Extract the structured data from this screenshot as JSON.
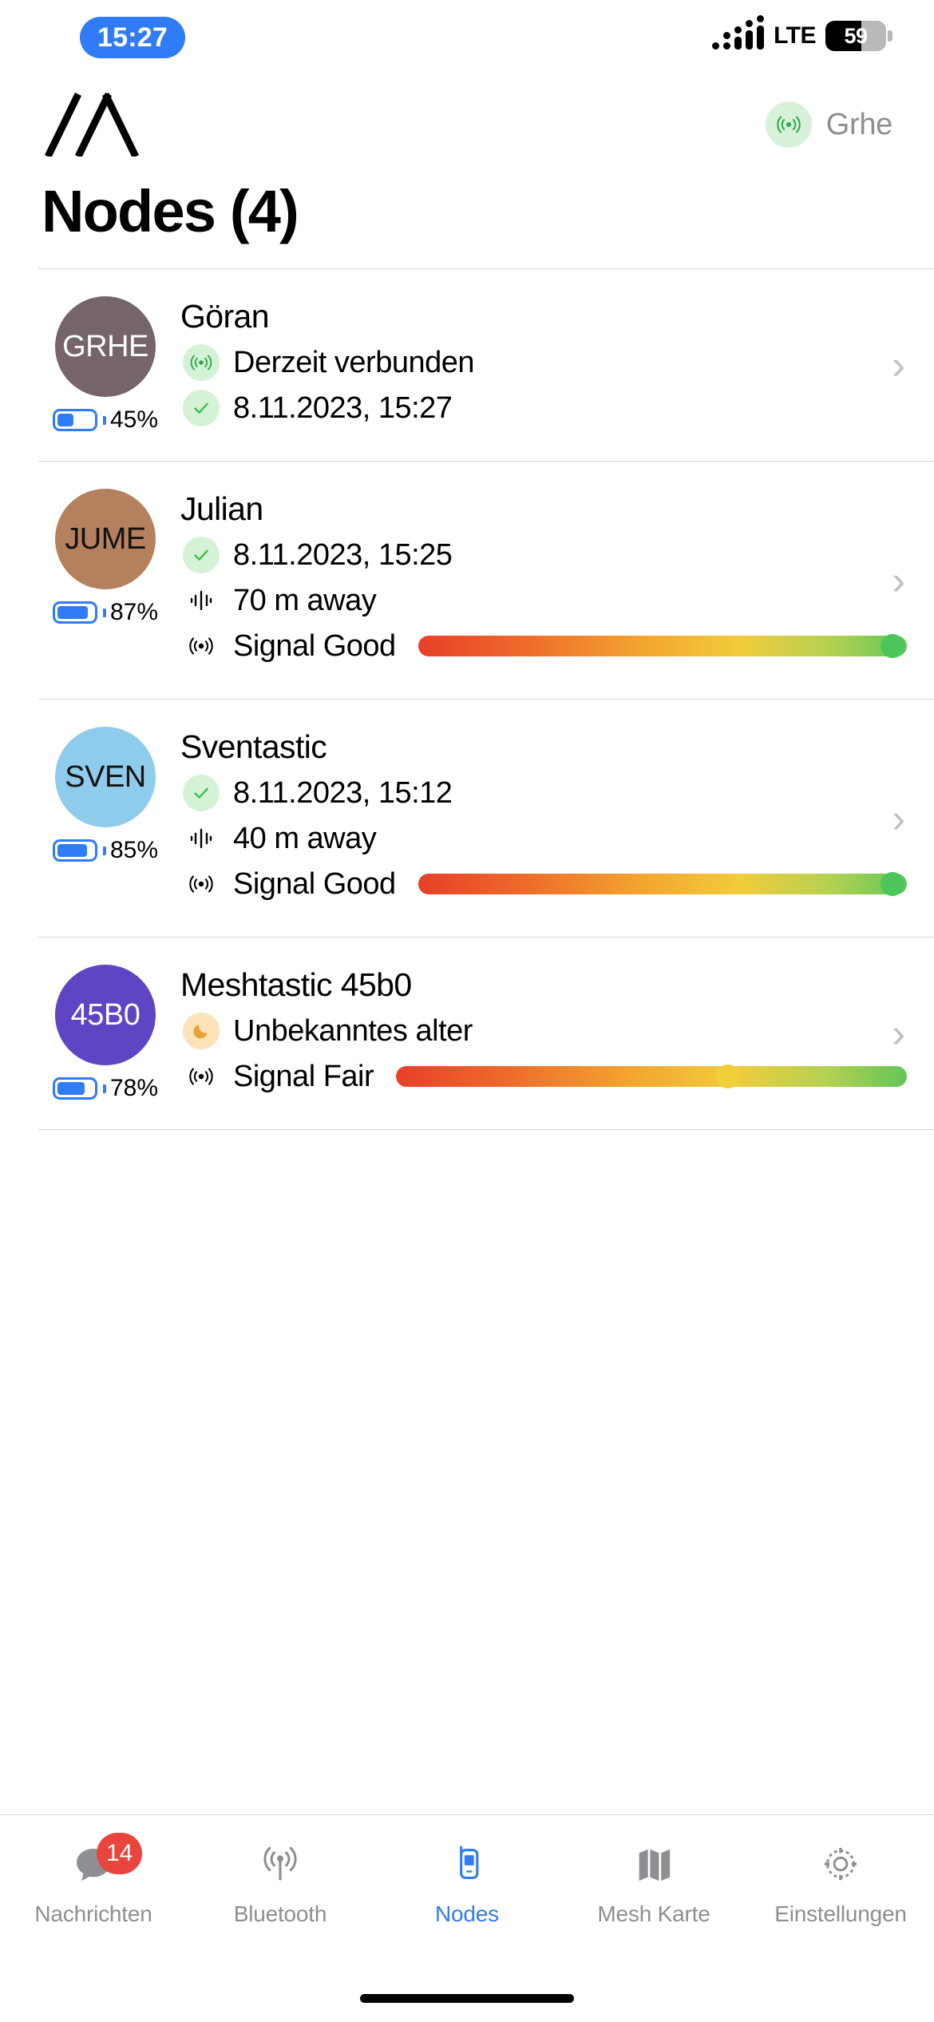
{
  "status_bar": {
    "time": "15:27",
    "carrier_network": "LTE",
    "battery_percent": "59",
    "battery_level": 59,
    "signal_icon": "cellular-dots-icon"
  },
  "header": {
    "logo_icon": "meshtastic-logo-icon",
    "connection_icon": "broadcast-icon",
    "connection_label": "Grhe",
    "connection_chip_color": "#D7F2D9"
  },
  "page": {
    "title": "Nodes (4)"
  },
  "colors": {
    "accent": "#307BF6",
    "badge_red": "#E8453C",
    "green_badge_bg": "#D4F3D6",
    "orange_badge_bg": "#FBE2B8",
    "inactive_gray": "#8E8E93"
  },
  "nodes": [
    {
      "short_name": "GRHE",
      "name": "Göran",
      "avatar_color": "#76646D",
      "avatar_text_color": "#FFFFFF",
      "battery_percent": "45%",
      "battery_level": 45,
      "meta": [
        {
          "icon": "broadcast-icon",
          "badge": "green",
          "text": "Derzeit verbunden"
        },
        {
          "icon": "check-icon",
          "badge": "green",
          "text": "8.11.2023, 15:27"
        }
      ],
      "signal": null,
      "chevron": "chevron-right-icon"
    },
    {
      "short_name": "JUME",
      "name": "Julian",
      "avatar_color": "#B5805D",
      "avatar_text_color": "#111111",
      "battery_percent": "87%",
      "battery_level": 87,
      "meta": [
        {
          "icon": "check-icon",
          "badge": "green",
          "text": "8.11.2023, 15:25"
        },
        {
          "icon": "waveform-icon",
          "badge": "none",
          "text": "70 m away"
        }
      ],
      "signal": {
        "icon": "signal-waves-icon",
        "label": "Signal Good",
        "position_pct": 97,
        "dot_color": "#4CC55A"
      },
      "chevron": "chevron-right-icon"
    },
    {
      "short_name": "SVEN",
      "name": "Sventastic",
      "avatar_color": "#8FCBEA",
      "avatar_text_color": "#111111",
      "battery_percent": "85%",
      "battery_level": 85,
      "meta": [
        {
          "icon": "check-icon",
          "badge": "green",
          "text": "8.11.2023, 15:12"
        },
        {
          "icon": "waveform-icon",
          "badge": "none",
          "text": "40 m away"
        }
      ],
      "signal": {
        "icon": "signal-waves-icon",
        "label": "Signal Good",
        "position_pct": 97,
        "dot_color": "#4CC55A"
      },
      "chevron": "chevron-right-icon"
    },
    {
      "short_name": "45B0",
      "name": "Meshtastic 45b0",
      "avatar_color": "#5F44C4",
      "avatar_text_color": "#FFFFFF",
      "battery_percent": "78%",
      "battery_level": 78,
      "meta": [
        {
          "icon": "moon-icon",
          "badge": "orange",
          "text": "Unbekanntes alter"
        }
      ],
      "signal": {
        "icon": "signal-waves-icon",
        "label": "Signal Fair",
        "position_pct": 65,
        "dot_color": "#F1D03C"
      },
      "chevron": "chevron-right-icon"
    }
  ],
  "tab_bar": {
    "items": [
      {
        "label": "Nachrichten",
        "icon": "message-bubble-icon",
        "badge": "14",
        "active": false
      },
      {
        "label": "Bluetooth",
        "icon": "broadcast-antenna-icon",
        "badge": null,
        "active": false
      },
      {
        "label": "Nodes",
        "icon": "mobile-phone-icon",
        "badge": null,
        "active": true
      },
      {
        "label": "Mesh Karte",
        "icon": "map-icon",
        "badge": null,
        "active": false
      },
      {
        "label": "Einstellungen",
        "icon": "gear-icon",
        "badge": null,
        "active": false
      }
    ]
  }
}
